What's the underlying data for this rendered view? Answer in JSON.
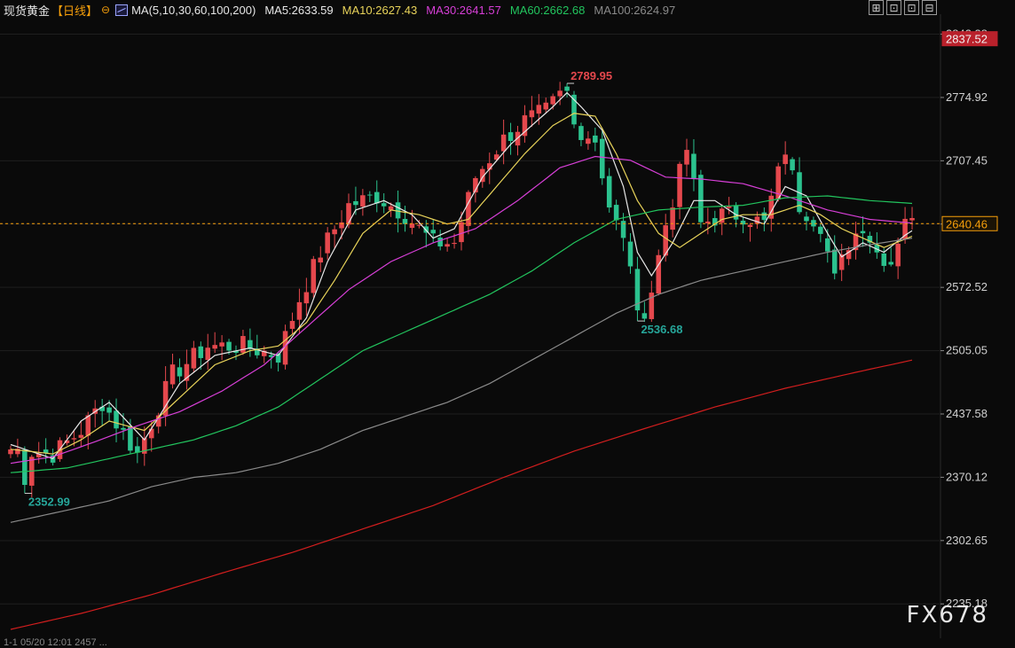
{
  "header": {
    "title": "现货黄金",
    "period": "【日线】",
    "toggle_symbol": "⊖",
    "ma_params": "MA(5,10,30,60,100,200)",
    "ma_items": [
      {
        "text": "MA5:2633.59",
        "color": "#e8e8e8"
      },
      {
        "text": "MA10:2627.43",
        "color": "#e8d35a"
      },
      {
        "text": "MA30:2641.57",
        "color": "#d73fd7"
      },
      {
        "text": "MA60:2662.68",
        "color": "#22c55e"
      },
      {
        "text": "MA100:2624.97",
        "color": "#8a8a8a"
      }
    ]
  },
  "toolbar": [
    "⊞",
    "⊡",
    "⊡",
    "⊟"
  ],
  "watermark": "FX678",
  "footer": "1-1 05/20 12:01 2457 ...",
  "chart_data": {
    "type": "candlestick",
    "y_axis": {
      "ticks": [
        2842.38,
        2774.92,
        2707.45,
        2639.98,
        2572.52,
        2505.05,
        2437.58,
        2370.12,
        2302.65,
        2235.18
      ],
      "ylim": [
        2208,
        2858
      ]
    },
    "price_labels": [
      {
        "value": 2837.52,
        "text": "2837.52",
        "color": "#b9212b"
      },
      {
        "value": 2640.46,
        "text": "2640.46",
        "color": "#f59e0b"
      }
    ],
    "current_price": 2640.46,
    "annotations": [
      {
        "text": "2789.95",
        "value": 2789.95,
        "at_bar": 79,
        "color": "#e5484d",
        "side": "right"
      },
      {
        "text": "2536.68",
        "value": 2536.68,
        "at_bar": 89,
        "color": "#26a69a",
        "side": "right"
      },
      {
        "text": "2352.99",
        "value": 2352.99,
        "at_bar": 2,
        "color": "#26a69a",
        "side": "right"
      }
    ],
    "colors": {
      "up": "#e5484d",
      "down": "#2bc28e",
      "grid": "#1f1f1f",
      "axis_text": "#d0d0d0"
    },
    "close_path": [
      [
        0,
        2400
      ],
      [
        6,
        2395
      ],
      [
        10,
        2420
      ],
      [
        13,
        2450
      ],
      [
        18,
        2395
      ],
      [
        23,
        2480
      ],
      [
        28,
        2510
      ],
      [
        33,
        2510
      ],
      [
        38,
        2500
      ],
      [
        41,
        2560
      ],
      [
        44,
        2610
      ],
      [
        48,
        2660
      ],
      [
        52,
        2670
      ],
      [
        56,
        2650
      ],
      [
        60,
        2620
      ],
      [
        63,
        2620
      ],
      [
        66,
        2690
      ],
      [
        70,
        2730
      ],
      [
        73,
        2750
      ],
      [
        76,
        2760
      ],
      [
        79,
        2785
      ],
      [
        80,
        2745
      ],
      [
        83,
        2730
      ],
      [
        85,
        2660
      ],
      [
        87,
        2620
      ],
      [
        88,
        2600
      ],
      [
        90,
        2550
      ],
      [
        91,
        2570
      ],
      [
        93,
        2640
      ],
      [
        96,
        2720
      ],
      [
        98,
        2640
      ],
      [
        101,
        2650
      ],
      [
        104,
        2650
      ],
      [
        107,
        2640
      ],
      [
        110,
        2720
      ],
      [
        112,
        2660
      ],
      [
        115,
        2640
      ],
      [
        117,
        2580
      ],
      [
        119,
        2620
      ],
      [
        121,
        2640
      ],
      [
        123,
        2610
      ],
      [
        125,
        2600
      ],
      [
        127,
        2650
      ],
      [
        128,
        2640
      ]
    ],
    "bar_count": 129,
    "series": [
      {
        "name": "MA5",
        "color": "#e8e8e8",
        "values": [
          [
            0,
            2405
          ],
          [
            6,
            2390
          ],
          [
            10,
            2430
          ],
          [
            14,
            2450
          ],
          [
            19,
            2410
          ],
          [
            24,
            2470
          ],
          [
            29,
            2500
          ],
          [
            34,
            2508
          ],
          [
            38,
            2500
          ],
          [
            42,
            2540
          ],
          [
            45,
            2600
          ],
          [
            49,
            2655
          ],
          [
            53,
            2665
          ],
          [
            57,
            2650
          ],
          [
            60,
            2625
          ],
          [
            63,
            2635
          ],
          [
            67,
            2690
          ],
          [
            71,
            2725
          ],
          [
            74,
            2745
          ],
          [
            77,
            2765
          ],
          [
            79,
            2780
          ],
          [
            81,
            2765
          ],
          [
            84,
            2740
          ],
          [
            87,
            2680
          ],
          [
            89,
            2610
          ],
          [
            91,
            2585
          ],
          [
            94,
            2620
          ],
          [
            97,
            2665
          ],
          [
            100,
            2665
          ],
          [
            103,
            2650
          ],
          [
            107,
            2640
          ],
          [
            110,
            2680
          ],
          [
            113,
            2670
          ],
          [
            116,
            2630
          ],
          [
            118,
            2605
          ],
          [
            121,
            2620
          ],
          [
            124,
            2610
          ],
          [
            127,
            2628
          ],
          [
            128,
            2633
          ]
        ]
      },
      {
        "name": "MA10",
        "color": "#e8d35a",
        "values": [
          [
            0,
            2400
          ],
          [
            6,
            2395
          ],
          [
            10,
            2410
          ],
          [
            14,
            2430
          ],
          [
            19,
            2420
          ],
          [
            24,
            2455
          ],
          [
            29,
            2490
          ],
          [
            34,
            2505
          ],
          [
            38,
            2510
          ],
          [
            42,
            2535
          ],
          [
            46,
            2580
          ],
          [
            50,
            2630
          ],
          [
            54,
            2655
          ],
          [
            58,
            2650
          ],
          [
            62,
            2640
          ],
          [
            65,
            2645
          ],
          [
            69,
            2680
          ],
          [
            73,
            2715
          ],
          [
            77,
            2745
          ],
          [
            80,
            2758
          ],
          [
            83,
            2755
          ],
          [
            86,
            2715
          ],
          [
            89,
            2665
          ],
          [
            92,
            2630
          ],
          [
            95,
            2615
          ],
          [
            98,
            2630
          ],
          [
            101,
            2645
          ],
          [
            104,
            2650
          ],
          [
            108,
            2650
          ],
          [
            112,
            2660
          ],
          [
            115,
            2650
          ],
          [
            118,
            2635
          ],
          [
            121,
            2625
          ],
          [
            124,
            2615
          ],
          [
            128,
            2627
          ]
        ]
      },
      {
        "name": "MA30",
        "color": "#d73fd7",
        "values": [
          [
            0,
            2385
          ],
          [
            6,
            2392
          ],
          [
            12,
            2408
          ],
          [
            18,
            2425
          ],
          [
            24,
            2440
          ],
          [
            30,
            2462
          ],
          [
            36,
            2490
          ],
          [
            42,
            2530
          ],
          [
            48,
            2570
          ],
          [
            54,
            2600
          ],
          [
            60,
            2620
          ],
          [
            66,
            2635
          ],
          [
            72,
            2665
          ],
          [
            78,
            2700
          ],
          [
            83,
            2712
          ],
          [
            88,
            2708
          ],
          [
            93,
            2690
          ],
          [
            98,
            2688
          ],
          [
            104,
            2683
          ],
          [
            110,
            2670
          ],
          [
            116,
            2655
          ],
          [
            122,
            2645
          ],
          [
            128,
            2641
          ]
        ]
      },
      {
        "name": "MA60",
        "color": "#22c55e",
        "values": [
          [
            0,
            2375
          ],
          [
            8,
            2380
          ],
          [
            14,
            2390
          ],
          [
            20,
            2400
          ],
          [
            26,
            2410
          ],
          [
            32,
            2425
          ],
          [
            38,
            2445
          ],
          [
            44,
            2475
          ],
          [
            50,
            2505
          ],
          [
            56,
            2525
          ],
          [
            62,
            2545
          ],
          [
            68,
            2565
          ],
          [
            74,
            2590
          ],
          [
            80,
            2620
          ],
          [
            86,
            2645
          ],
          [
            92,
            2655
          ],
          [
            98,
            2658
          ],
          [
            104,
            2660
          ],
          [
            110,
            2668
          ],
          [
            116,
            2670
          ],
          [
            122,
            2665
          ],
          [
            128,
            2662
          ]
        ]
      },
      {
        "name": "MA100",
        "color": "#8a8a8a",
        "values": [
          [
            0,
            2322
          ],
          [
            8,
            2335
          ],
          [
            14,
            2345
          ],
          [
            20,
            2360
          ],
          [
            26,
            2370
          ],
          [
            32,
            2375
          ],
          [
            38,
            2385
          ],
          [
            44,
            2400
          ],
          [
            50,
            2420
          ],
          [
            56,
            2435
          ],
          [
            62,
            2450
          ],
          [
            68,
            2470
          ],
          [
            74,
            2495
          ],
          [
            80,
            2520
          ],
          [
            86,
            2545
          ],
          [
            92,
            2565
          ],
          [
            98,
            2580
          ],
          [
            104,
            2590
          ],
          [
            110,
            2600
          ],
          [
            116,
            2610
          ],
          [
            122,
            2618
          ],
          [
            128,
            2625
          ]
        ]
      },
      {
        "name": "MA200",
        "color": "#d21e1e",
        "values": [
          [
            0,
            2208
          ],
          [
            10,
            2225
          ],
          [
            20,
            2245
          ],
          [
            30,
            2268
          ],
          [
            40,
            2290
          ],
          [
            50,
            2315
          ],
          [
            60,
            2340
          ],
          [
            70,
            2370
          ],
          [
            80,
            2398
          ],
          [
            90,
            2422
          ],
          [
            100,
            2445
          ],
          [
            110,
            2465
          ],
          [
            120,
            2482
          ],
          [
            128,
            2495
          ]
        ]
      }
    ]
  }
}
